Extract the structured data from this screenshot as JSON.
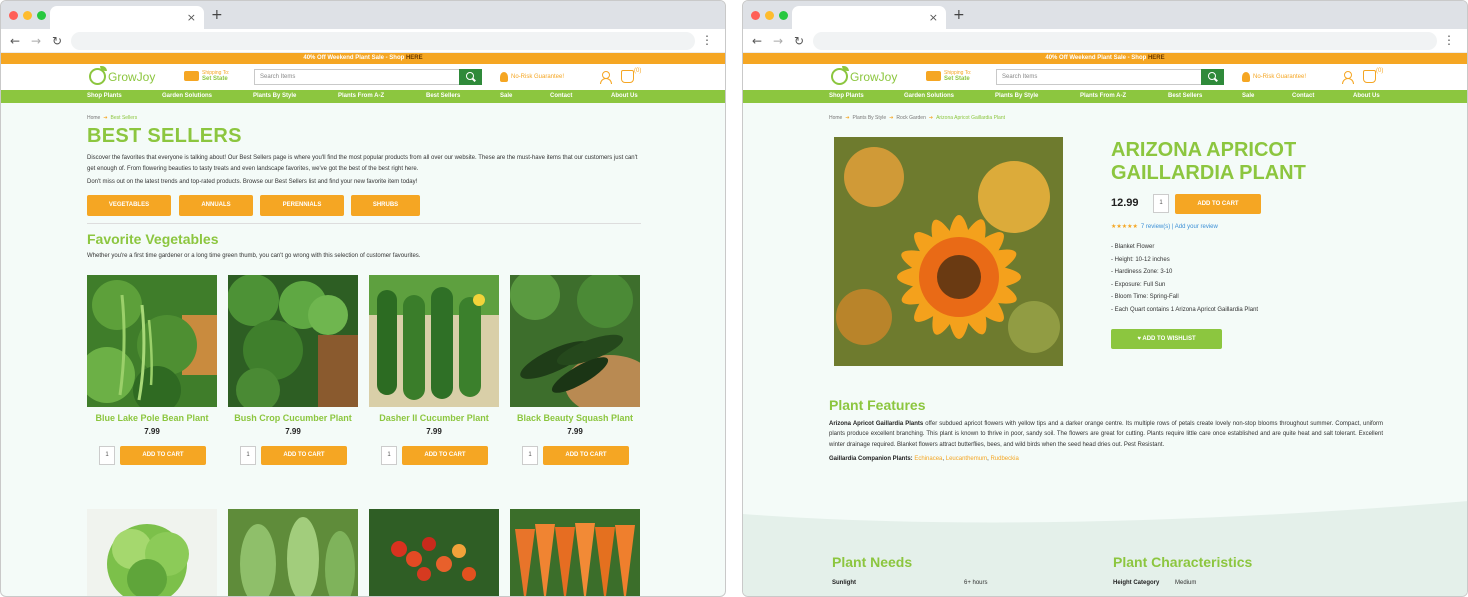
{
  "browser": {
    "close_glyph": "×",
    "new_tab_glyph": "+",
    "back_glyph": "←",
    "forward_glyph": "→",
    "reload_glyph": "↻",
    "menu_glyph": "⋮"
  },
  "site": {
    "promo": "40% Off Weekend Plant Sale - Shop ",
    "promo_link": "HERE",
    "logo": "GrowJoy",
    "shipping_to": "Shipping To:",
    "set_state": "Set State",
    "search_placeholder": "Search Items",
    "guarantee": "No-Risk Guarantee!",
    "cart_count": "(0)",
    "nav": [
      "Shop Plants",
      "Garden Solutions",
      "Plants By Style",
      "Plants From A-Z",
      "Best Sellers",
      "Sale",
      "Contact",
      "About Us"
    ]
  },
  "left": {
    "breadcrumb": [
      "Home",
      "Best Sellers"
    ],
    "title": "BEST SELLERS",
    "intro": "Discover the favorites that everyone is talking about! Our Best Sellers page is where you'll find the most popular products from all over our website. These are the must-have items that our customers just can't get enough of. From flowering beauties to tasty treats and even landscape favorites, we've got the best of the best right here.",
    "intro2": "Don't miss out on the latest trends and top-rated products. Browse our Best Sellers list and find your new favorite item today!",
    "categories": [
      "VEGETABLES",
      "ANNUALS",
      "PERENNIALS",
      "SHRUBS"
    ],
    "section_title": "Favorite Vegetables",
    "section_desc": "Whether you're a first time gardener or a long time green thumb, you can't go wrong with this selection of customer favourites.",
    "add_to_cart": "ADD TO CART",
    "qty": "1",
    "products": [
      {
        "name": "Blue Lake Pole Bean Plant",
        "price": "7.99"
      },
      {
        "name": "Bush Crop Cucumber Plant",
        "price": "7.99"
      },
      {
        "name": "Dasher II Cucumber Plant",
        "price": "7.99"
      },
      {
        "name": "Black Beauty Squash Plant",
        "price": "7.99"
      }
    ]
  },
  "right": {
    "breadcrumb": [
      "Home",
      "Plants By Style",
      "Rock Garden",
      "Arizona Apricot Gaillardia Plant"
    ],
    "title": "ARIZONA APRICOT GAILLARDIA PLANT",
    "price": "12.99",
    "qty": "1",
    "add_to_cart": "ADD TO CART",
    "stars": "★★★★★",
    "reviews": "7 review(s) | Add your review",
    "specs": [
      "- Blanket Flower",
      "- Height: 10-12 inches",
      "- Hardiness Zone: 3-10",
      "- Exposure: Full Sun",
      "- Bloom Time: Spring-Fall",
      "- Each Quart contains 1 Arizona Apricot Gaillardia Plant"
    ],
    "wishlist": "ADD TO WISHLIST",
    "features_title": "Plant Features",
    "features_bold": "Arizona Apricot Gaillardia Plants",
    "features_text": " offer subdued apricot flowers with yellow tips and a darker orange centre. Its multiple rows of petals create lovely non-stop blooms throughout summer. Compact, uniform plants produce excellent branching. This plant is known to thrive in poor, sandy soil. The flowers are great for cutting. Plants require little care once established and are quite heat and salt tolerant. Excellent winter drainage required. Blanket flowers attract butterflies, bees, and wild birds when the seed head dries out. Pest Resistant.",
    "companion_label": "Gaillardia Companion Plants: ",
    "companions": [
      "Echinacea",
      "Leucanthemum",
      "Rudbeckia"
    ],
    "needs_title": "Plant Needs",
    "chars_title": "Plant Characteristics",
    "sunlight_label": "Sunlight",
    "sunlight_value": "6+ hours",
    "height_label": "Height Category",
    "height_value": "Medium"
  },
  "colors": {
    "brand_green": "#8cc63f",
    "brand_orange": "#f5a623",
    "dark_green": "#2f8a3a"
  }
}
